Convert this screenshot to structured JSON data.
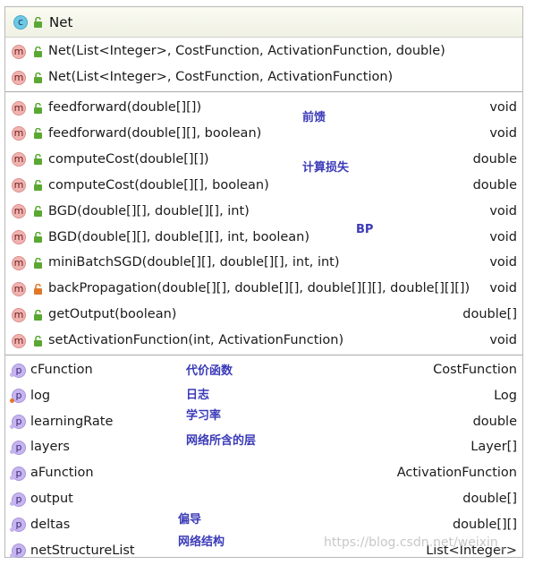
{
  "class": {
    "name": "Net",
    "icon": "class-icon",
    "badge": "c"
  },
  "constructors": [
    {
      "signature": "Net(List<Integer>, CostFunction, ActivationFunction, double)",
      "badge": "m",
      "access": "public"
    },
    {
      "signature": "Net(List<Integer>, CostFunction, ActivationFunction)",
      "badge": "m",
      "access": "public"
    }
  ],
  "methods": [
    {
      "signature": "feedforward(double[][])",
      "type": "void",
      "badge": "m",
      "access": "public"
    },
    {
      "signature": "feedforward(double[][], boolean)",
      "type": "void",
      "badge": "m",
      "access": "public"
    },
    {
      "signature": "computeCost(double[][])",
      "type": "double",
      "badge": "m",
      "access": "public"
    },
    {
      "signature": "computeCost(double[][], boolean)",
      "type": "double",
      "badge": "m",
      "access": "public"
    },
    {
      "signature": "BGD(double[][], double[][], int)",
      "type": "void",
      "badge": "m",
      "access": "public"
    },
    {
      "signature": "BGD(double[][], double[][], int, boolean)",
      "type": "void",
      "badge": "m",
      "access": "public"
    },
    {
      "signature": "miniBatchSGD(double[][], double[][], int, int)",
      "type": "void",
      "badge": "m",
      "access": "public"
    },
    {
      "signature": "backPropagation(double[][], double[][], double[][][], double[][][])",
      "type": "void",
      "badge": "m",
      "access": "private"
    },
    {
      "signature": "getOutput(boolean)",
      "type": "double[]",
      "badge": "m",
      "access": "public"
    },
    {
      "signature": "setActivationFunction(int, ActivationFunction)",
      "type": "void",
      "badge": "m",
      "access": "public"
    }
  ],
  "fields": [
    {
      "name": "cFunction",
      "type": "CostFunction",
      "badge": "p"
    },
    {
      "name": "log",
      "type": "Log",
      "badge": "p"
    },
    {
      "name": "learningRate",
      "type": "double",
      "badge": "p"
    },
    {
      "name": "layers",
      "type": "Layer[]",
      "badge": "p"
    },
    {
      "name": "aFunction",
      "type": "ActivationFunction",
      "badge": "p"
    },
    {
      "name": "output",
      "type": "double[]",
      "badge": "p"
    },
    {
      "name": "deltas",
      "type": "double[][]",
      "badge": "p"
    },
    {
      "name": "netStructureList",
      "type": "List<Integer>",
      "badge": "p"
    }
  ],
  "annotations": [
    "前馈",
    "计算损失",
    "BP",
    "代价函数",
    "日志",
    "学习率",
    "网络所含的层",
    "偏导",
    "网络结构"
  ],
  "watermark": "https://blog.csdn.net/weixin_",
  "colors": {
    "class_badge": "#6ec8e6",
    "method_badge": "#f2b3b0",
    "field_badge": "#c6b5ef",
    "public_lock": "#5aa832",
    "private_lock": "#e0782a",
    "annotation": "#3a3ab8"
  }
}
